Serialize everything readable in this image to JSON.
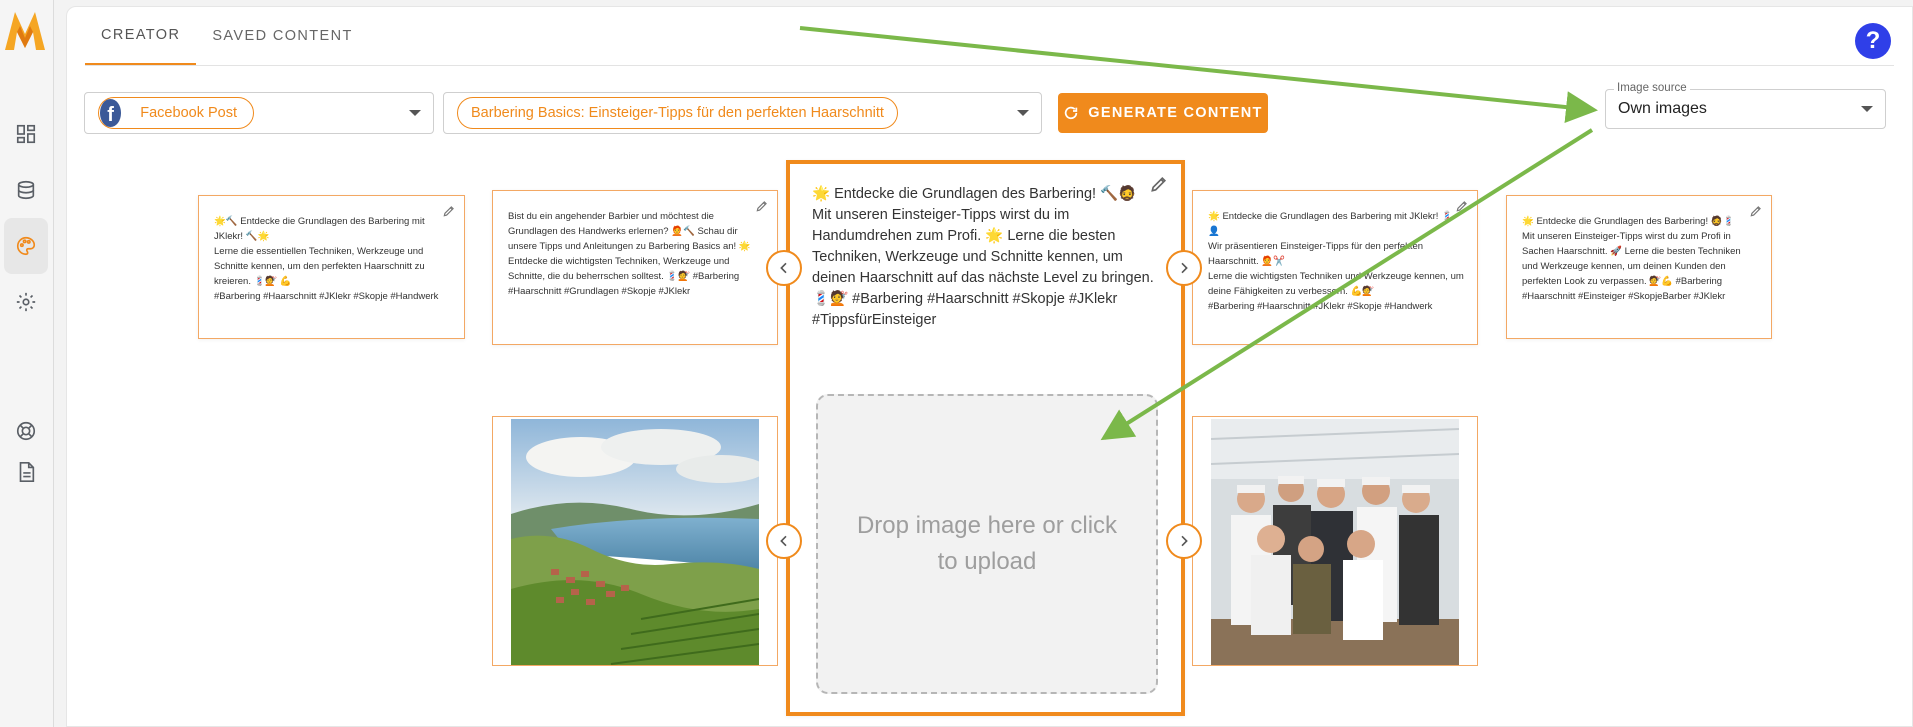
{
  "tabs": [
    {
      "label": "Creator"
    },
    {
      "label": "Saved content"
    }
  ],
  "toolbar": {
    "platform": "Facebook Post",
    "topic": "Barbering Basics: Einsteiger-Tipps für den perfekten Haarschnitt",
    "generate_label": "Generate content",
    "image_source_label": "Image source",
    "image_source_value": "Own images"
  },
  "posts": [
    {
      "text": "🌟🔨 Entdecke die Grundlagen des Barbering mit JKlekr! 🔨🌟\nLerne die essentiellen Techniken, Werkzeuge und Schnitte kennen, um den perfekten Haarschnitt zu kreieren. 💈💇 💪\n#Barbering #Haarschnitt #JKlekr #Skopje #Handwerk"
    },
    {
      "text": "Bist du ein angehender Barbier und möchtest die Grundlagen des Handwerks erlernen? 🧑‍🦰🔨 Schau dir unsere Tipps und Anleitungen zu Barbering Basics an! 🌟 Entdecke die wichtigsten Techniken, Werkzeuge und Schnitte, die du beherrschen solltest. 💈💇 #Barbering #Haarschnitt #Grundlagen #Skopje #JKlekr"
    },
    {
      "text": "🌟 Entdecke die Grundlagen des Barbering! 🔨🧔\nMit unseren Einsteiger-Tipps wirst du im Handumdrehen zum Profi. 🌟 Lerne die besten Techniken, Werkzeuge und Schnitte kennen, um deinen Haarschnitt auf das nächste Level zu bringen. 💈💇 #Barbering #Haarschnitt #Skopje #JKlekr #TippsfürEinsteiger"
    },
    {
      "text": "🌟 Entdecke die Grundlagen des Barbering mit JKlekr! 💈 👤\nWir präsentieren Einsteiger-Tipps für den perfekten Haarschnitt. 🧑‍🦰✂️\nLerne die wichtigsten Techniken und Werkzeuge kennen, um deine Fähigkeiten zu verbessern. 💪💇\n#Barbering #Haarschnitt #JKlekr #Skopje #Handwerk"
    },
    {
      "text": "🌟 Entdecke die Grundlagen des Barbering! 🧔💈\nMit unseren Einsteiger-Tipps wirst du zum Profi in Sachen Haarschnitt. 🚀 Lerne die besten Techniken und Werkzeuge kennen, um deinen Kunden den perfekten Look zu verpassen. 💇💪 #Barbering #Haarschnitt #Einsteiger #SkopjeBarber #JKlekr"
    }
  ],
  "upload": {
    "drop_text": "Drop image here or click to upload"
  },
  "colors": {
    "accent": "#f08a1c",
    "help": "#2f3fe8",
    "annotation_arrow": "#7bb84a"
  }
}
